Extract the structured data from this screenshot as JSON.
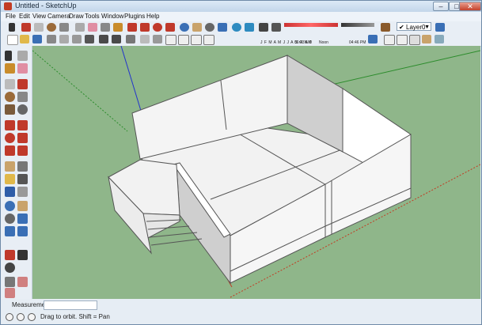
{
  "window": {
    "title": "Untitled - SketchUp"
  },
  "menu": [
    "File",
    "Edit",
    "View",
    "Camera",
    "Draw",
    "Tools",
    "Window",
    "Plugins",
    "Help"
  ],
  "shadow_bar": {
    "months": "J F M A M J J A S O N D",
    "time_start": "06:43 AM",
    "time_mid": "Noon",
    "time_end": "04:46 PM"
  },
  "layer": {
    "current": "Layer0"
  },
  "status": {
    "measurements_label": "Measurements",
    "hint": "Drag to orbit.  Shift = Pan"
  },
  "colors": {
    "viewport_ground": "#8fb68a",
    "wall_light": "#f2f2f2",
    "wall_shade": "#cfcfcf",
    "axis_red": "#c23b22",
    "axis_green": "#2c8c2c",
    "axis_blue": "#2233cc"
  }
}
